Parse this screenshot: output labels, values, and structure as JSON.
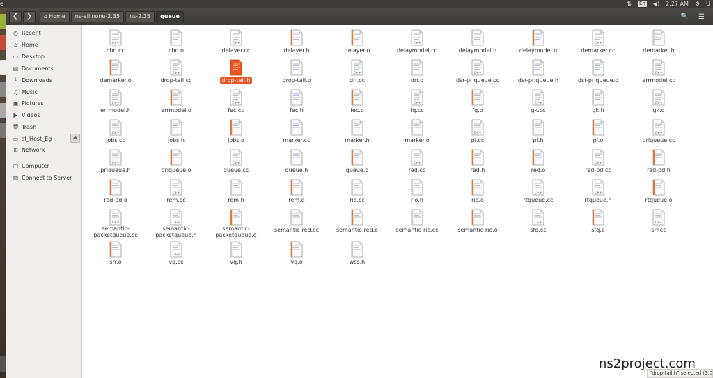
{
  "topbar": {
    "left_glyph": "e",
    "net_icon": "⇅",
    "keyboard": "En",
    "volume_icon": "◀)",
    "time": "2:27 AM",
    "settings_icon": "⚙",
    "user": "U"
  },
  "nav": {
    "back": "❮",
    "forward": "❯",
    "home_glyph": "⌂",
    "crumbs": [
      "Home",
      "ns-allinone-2.35",
      "ns-2.35",
      "queue"
    ],
    "search_icon": "🔍",
    "menu_icon": "☰"
  },
  "sidebar": {
    "items": [
      {
        "label": "Recent",
        "icon": "◷",
        "icon_name": "clock-icon"
      },
      {
        "label": "Home",
        "icon": "⌂",
        "icon_name": "home-icon"
      },
      {
        "label": "Desktop",
        "icon": "▭",
        "icon_name": "desktop-icon"
      },
      {
        "label": "Documents",
        "icon": "▤",
        "icon_name": "documents-icon"
      },
      {
        "label": "Downloads",
        "icon": "⤓",
        "icon_name": "downloads-icon"
      },
      {
        "label": "Music",
        "icon": "♫",
        "icon_name": "music-icon"
      },
      {
        "label": "Pictures",
        "icon": "▣",
        "icon_name": "pictures-icon"
      },
      {
        "label": "Videos",
        "icon": "▶",
        "icon_name": "videos-icon"
      },
      {
        "label": "Trash",
        "icon": "🗑",
        "icon_name": "trash-icon"
      },
      {
        "label": "sf_Host_Eg",
        "icon": "▭",
        "icon_name": "drive-icon"
      },
      {
        "label": "Network",
        "icon": "⊞",
        "icon_name": "network-icon"
      },
      {
        "label": "Computer",
        "icon": "▢",
        "icon_name": "computer-icon"
      },
      {
        "label": "Connect to Server",
        "icon": "▥",
        "icon_name": "server-icon"
      }
    ],
    "eject_icon": "⏏"
  },
  "files": [
    {
      "name": "cbq.cc",
      "type": "cc"
    },
    {
      "name": "cbq.o",
      "type": "o"
    },
    {
      "name": "delayer.cc",
      "type": "cc"
    },
    {
      "name": "delayer.h",
      "type": "h"
    },
    {
      "name": "delayer.o",
      "type": "h"
    },
    {
      "name": "delaymodel.cc",
      "type": "cc"
    },
    {
      "name": "delaymodel.h",
      "type": "o"
    },
    {
      "name": "delaymodel.o",
      "type": "h"
    },
    {
      "name": "demarker.cc",
      "type": "cc"
    },
    {
      "name": "demarker.h",
      "type": "o"
    },
    {
      "name": "demarker.o",
      "type": "h"
    },
    {
      "name": "drop-tail.cc",
      "type": "cc"
    },
    {
      "name": "drop-tail.h",
      "type": "h",
      "selected": true
    },
    {
      "name": "drop-tail.o",
      "type": "o"
    },
    {
      "name": "drr.cc",
      "type": "cc"
    },
    {
      "name": "drr.o",
      "type": "o"
    },
    {
      "name": "dsr-priqueue.cc",
      "type": "cc"
    },
    {
      "name": "dsr-priqueue.h",
      "type": "o"
    },
    {
      "name": "dsr-priqueue.o",
      "type": "o"
    },
    {
      "name": "errmodel.cc",
      "type": "cc"
    },
    {
      "name": "errmodel.h",
      "type": "cc"
    },
    {
      "name": "errmodel.o",
      "type": "h"
    },
    {
      "name": "fec.cc",
      "type": "cc"
    },
    {
      "name": "fec.h",
      "type": "o"
    },
    {
      "name": "fec.o",
      "type": "h"
    },
    {
      "name": "fq.cc",
      "type": "cc"
    },
    {
      "name": "fq.o",
      "type": "h"
    },
    {
      "name": "gk.cc",
      "type": "cc"
    },
    {
      "name": "gk.h",
      "type": "o"
    },
    {
      "name": "gk.o",
      "type": "cc"
    },
    {
      "name": "jobs.cc",
      "type": "cc"
    },
    {
      "name": "jobs.h",
      "type": "o"
    },
    {
      "name": "jobs.o",
      "type": "h"
    },
    {
      "name": "marker.cc",
      "type": "o"
    },
    {
      "name": "marker.h",
      "type": "o"
    },
    {
      "name": "marker.o",
      "type": "o"
    },
    {
      "name": "pi.cc",
      "type": "cc"
    },
    {
      "name": "pi.h",
      "type": "o"
    },
    {
      "name": "pi.o",
      "type": "h"
    },
    {
      "name": "priqueue.cc",
      "type": "cc"
    },
    {
      "name": "priqueue.h",
      "type": "cc"
    },
    {
      "name": "priqueue.o",
      "type": "h"
    },
    {
      "name": "queue.cc",
      "type": "cc"
    },
    {
      "name": "queue.h",
      "type": "o"
    },
    {
      "name": "queue.o",
      "type": "h"
    },
    {
      "name": "red.cc",
      "type": "cc"
    },
    {
      "name": "red.h",
      "type": "h"
    },
    {
      "name": "red.o",
      "type": "h"
    },
    {
      "name": "red-pd.cc",
      "type": "cc"
    },
    {
      "name": "red-pd.h",
      "type": "h"
    },
    {
      "name": "red-pd.o",
      "type": "h"
    },
    {
      "name": "rem.cc",
      "type": "cc"
    },
    {
      "name": "rem.h",
      "type": "o"
    },
    {
      "name": "rem.o",
      "type": "h"
    },
    {
      "name": "rio.cc",
      "type": "o"
    },
    {
      "name": "rio.h",
      "type": "o"
    },
    {
      "name": "rio.o",
      "type": "h"
    },
    {
      "name": "rtqueue.cc",
      "type": "cc"
    },
    {
      "name": "rtqueue.h",
      "type": "cc"
    },
    {
      "name": "rtqueue.o",
      "type": "h"
    },
    {
      "name": "semantic-packetqueue.cc",
      "display": "semantic- packetqueue.cc",
      "type": "cc"
    },
    {
      "name": "semantic-packetqueue.h",
      "display": "semantic- packetqueue.h",
      "type": "cc"
    },
    {
      "name": "semantic-packetqueue.o",
      "display": "semantic- packetqueue.o",
      "type": "h"
    },
    {
      "name": "semantic-red.cc",
      "type": "o"
    },
    {
      "name": "semantic-red.o",
      "type": "h"
    },
    {
      "name": "semantic-rio.cc",
      "type": "o"
    },
    {
      "name": "semantic-rio.o",
      "type": "h"
    },
    {
      "name": "sfq.cc",
      "type": "cc"
    },
    {
      "name": "sfq.o",
      "type": "h"
    },
    {
      "name": "srr.cc",
      "type": "cc"
    },
    {
      "name": "srr.o",
      "type": "h"
    },
    {
      "name": "vq.cc",
      "type": "cc"
    },
    {
      "name": "vq.h",
      "type": "o"
    },
    {
      "name": "vq.o",
      "type": "h"
    },
    {
      "name": "wss.h",
      "type": "o"
    }
  ],
  "watermark": "ns2project.com",
  "status": "\"drop-tail.h\" selected (3.0",
  "colors": {
    "accent": "#e95420",
    "topbar": "#3c3b37",
    "sidebar": "#f0efed"
  }
}
